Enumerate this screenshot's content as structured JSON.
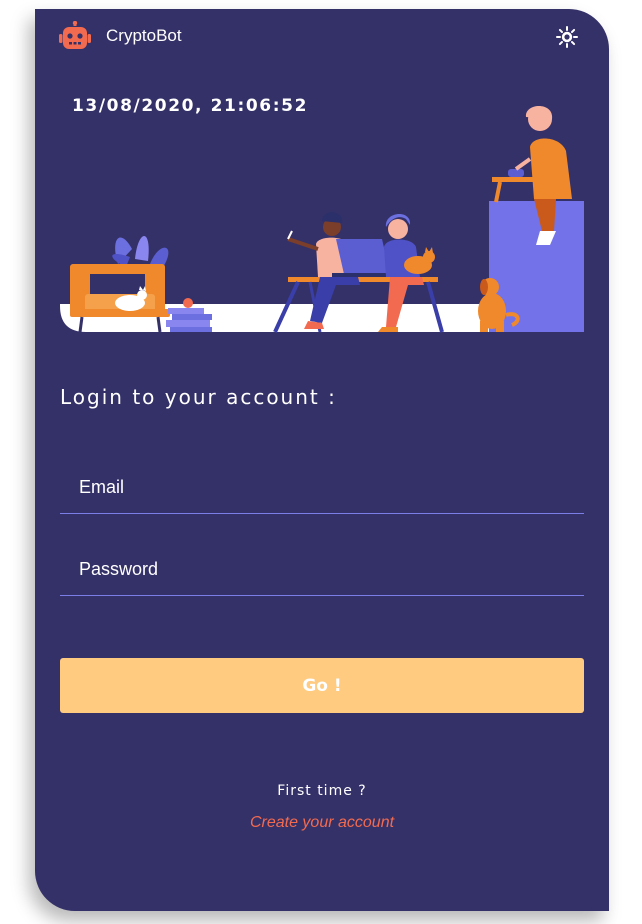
{
  "app": {
    "name": "CryptoBot"
  },
  "header": {
    "logo_icon": "robot-icon",
    "theme_icon": "sun-icon"
  },
  "clock": {
    "datetime": "13/08/2020, 21:06:52"
  },
  "login": {
    "heading": "Login to your account :",
    "email_placeholder": "Email",
    "password_placeholder": "Password",
    "submit_label": "Go !"
  },
  "signup": {
    "prompt": "First time ?",
    "link_label": "Create your account"
  },
  "colors": {
    "card_background": "#343168",
    "accent_orange": "#f26a4f",
    "button": "#ffcb80",
    "field_underline": "#7b7ee6",
    "illustration_purple": "#7472e8"
  }
}
